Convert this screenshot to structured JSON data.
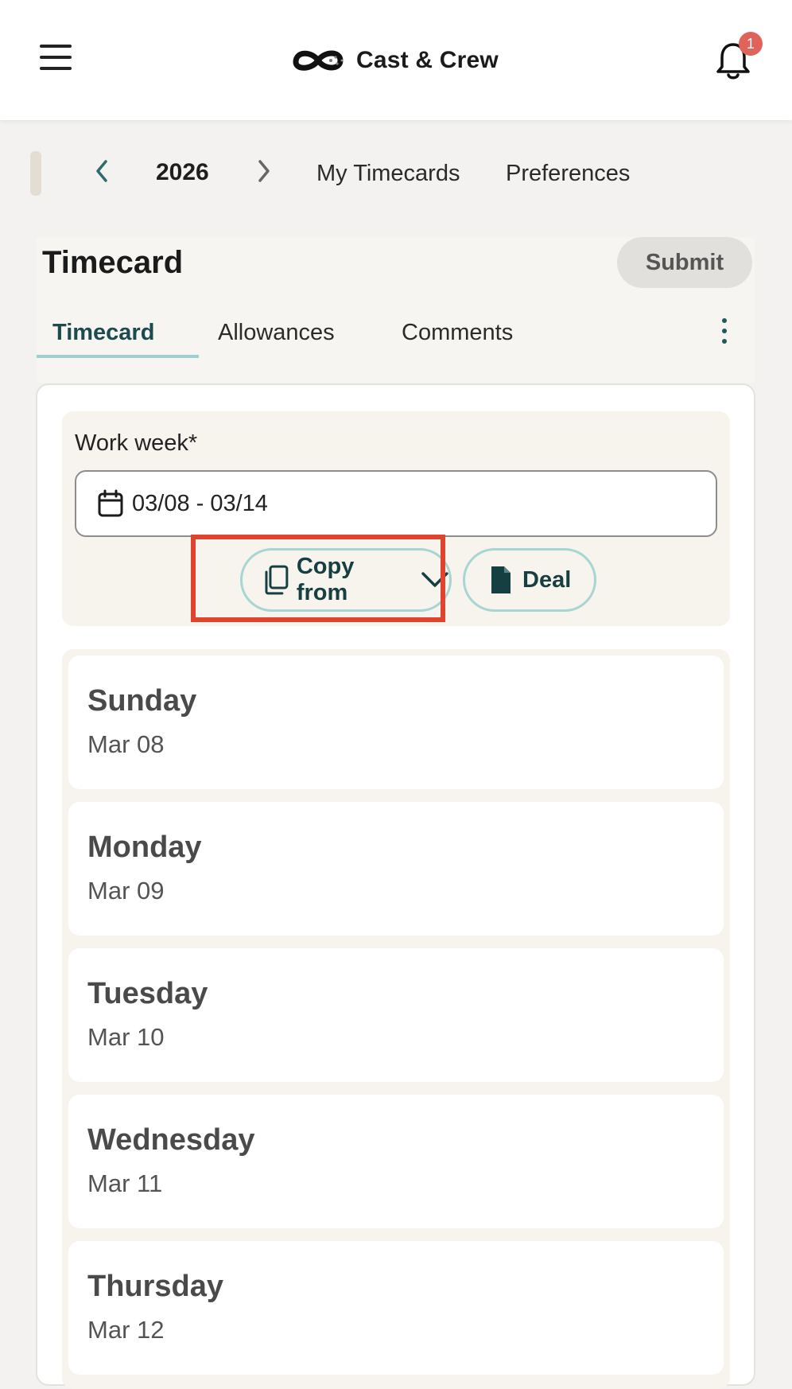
{
  "header": {
    "brand": "Cast & Crew",
    "notification_count": "1"
  },
  "year_nav": {
    "year": "2026",
    "links": [
      "My Timecards",
      "Preferences"
    ]
  },
  "timecard": {
    "title": "Timecard",
    "submit_label": "Submit",
    "tabs": [
      {
        "label": "Timecard",
        "active": true
      },
      {
        "label": "Allowances",
        "active": false
      },
      {
        "label": "Comments",
        "active": false
      }
    ],
    "work_week": {
      "label": "Work week*",
      "value": "03/08 - 03/14"
    },
    "copy_from_label": "Copy from",
    "deal_label": "Deal"
  },
  "days": [
    {
      "name": "Sunday",
      "date": "Mar 08"
    },
    {
      "name": "Monday",
      "date": "Mar 09"
    },
    {
      "name": "Tuesday",
      "date": "Mar 10"
    },
    {
      "name": "Wednesday",
      "date": "Mar 11"
    },
    {
      "name": "Thursday",
      "date": "Mar 12"
    }
  ],
  "colors": {
    "accent": "#1c4b4d",
    "pill_border": "#a6d5d3",
    "highlight": "#e0442e",
    "badge": "#e0625a"
  }
}
